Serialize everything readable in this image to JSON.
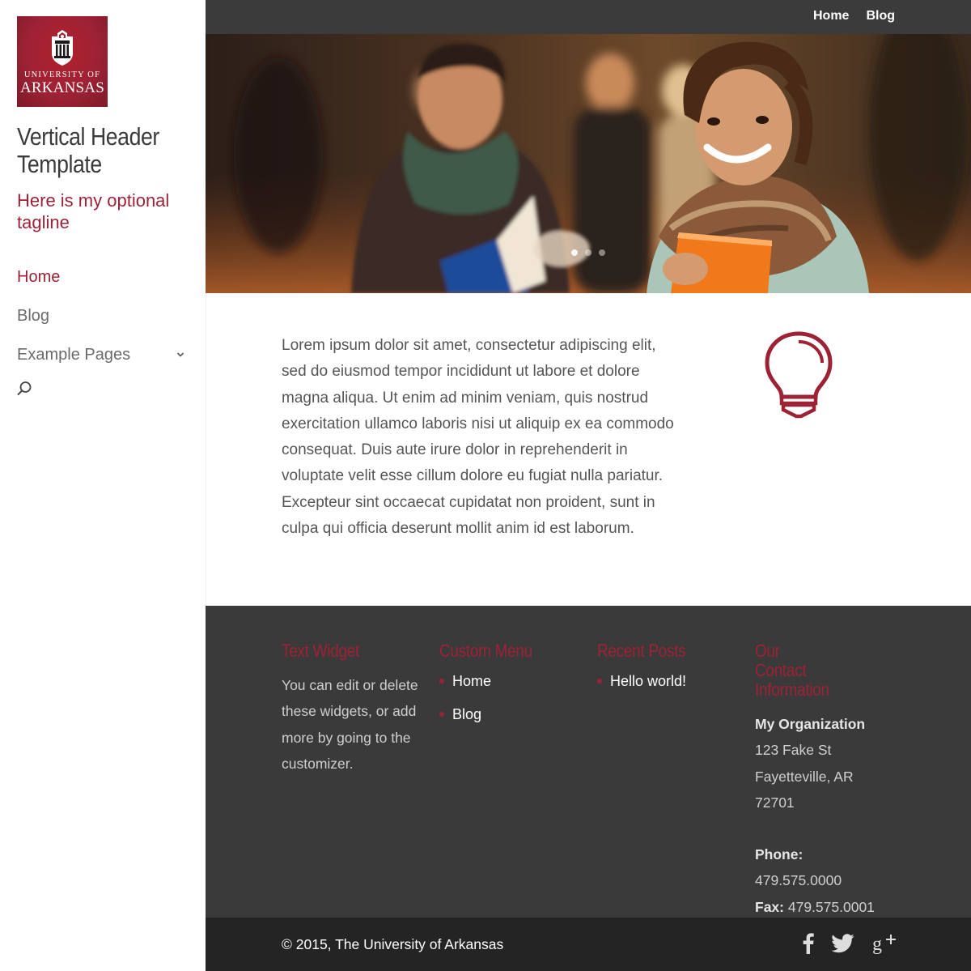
{
  "site": {
    "logo": {
      "line1": "UNIVERSITY OF",
      "line2": "ARKANSAS"
    },
    "title": "Vertical Header Template",
    "tagline": "Here is my optional tagline"
  },
  "sidebar_nav": [
    {
      "label": "Home",
      "active": true
    },
    {
      "label": "Blog",
      "active": false
    },
    {
      "label": "Example Pages",
      "active": false,
      "has_submenu": true
    }
  ],
  "top_nav": [
    {
      "label": "Home"
    },
    {
      "label": "Blog"
    }
  ],
  "hero": {
    "slides": 3,
    "active_slide": 1
  },
  "content": {
    "text": "Lorem ipsum dolor sit amet, consectetur adipiscing elit, sed do eiusmod tempor incididunt ut labore et dolore magna aliqua. Ut enim ad minim veniam, quis nostrud exercitation ullamco laboris nisi ut aliquip ex ea commodo consequat. Duis aute irure dolor in reprehenderit in voluptate velit esse cillum dolore eu fugiat nulla pariatur. Excepteur sint occaecat cupidatat non proident, sunt in culpa qui officia deserunt mollit anim id est laborum.",
    "icon": "lightbulb-icon"
  },
  "footer": {
    "text_widget": {
      "title": "Text Widget",
      "body": "You can edit or delete these widgets, or add more by going to the customizer."
    },
    "custom_menu": {
      "title": "Custom Menu",
      "items": [
        "Home",
        "Blog"
      ]
    },
    "recent_posts": {
      "title": "Recent Posts",
      "items": [
        "Hello world!"
      ]
    },
    "contact": {
      "title": "Our Contact Information",
      "org": "My Organization",
      "street": "123 Fake St",
      "city": "Fayetteville, AR",
      "zip": "72701",
      "phone_label": "Phone:",
      "phone": "479.575.0000",
      "fax_label": "Fax:",
      "fax": "479.575.0001"
    }
  },
  "bottom_bar": {
    "copyright": "© 2015, The University of Arkansas",
    "social": [
      "facebook-icon",
      "twitter-icon",
      "google-plus-icon"
    ]
  },
  "colors": {
    "brand": "#9d2235",
    "footer_bg": "#3a3a3a",
    "topbar_bg": "#3b3b3b",
    "bottom_bg": "#242424"
  }
}
